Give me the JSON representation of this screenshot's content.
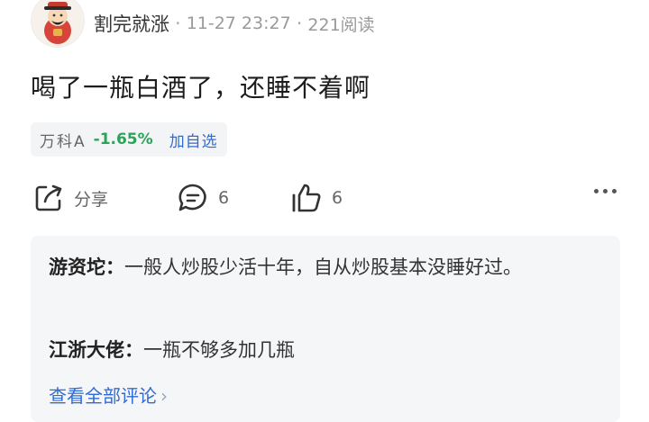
{
  "post": {
    "username": "割完就涨",
    "time": "11-27 23:27",
    "views": "221阅读",
    "content": "喝了一瓶白酒了，还睡不着啊"
  },
  "stock": {
    "name": "万科A",
    "change": "-1.65%",
    "add_label": "加自选",
    "change_color": "#2ba35a"
  },
  "actions": {
    "share_label": "分享",
    "comment_count": "6",
    "like_count": "6"
  },
  "comments": {
    "items": [
      {
        "author": "游资坨：",
        "text": "一般人炒股少活十年，自从炒股基本没睡好过。"
      },
      {
        "author": "江浙大佬：",
        "text": "一瓶不够多加几瓶"
      }
    ],
    "view_all": "查看全部评论"
  }
}
